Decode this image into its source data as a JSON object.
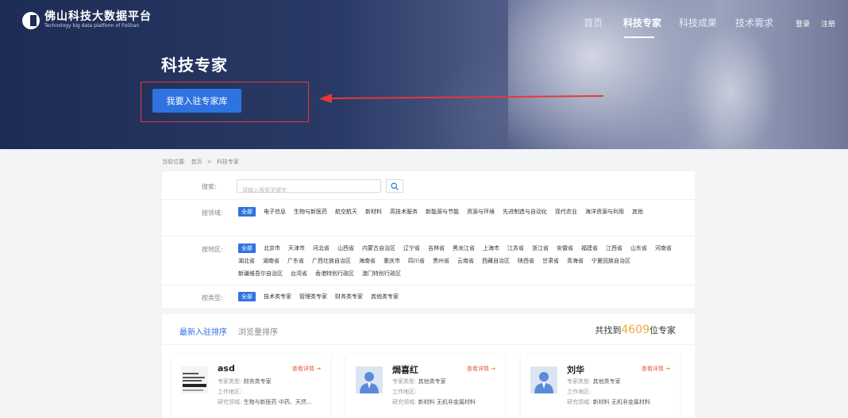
{
  "header": {
    "logo_title": "佛山科技大数据平台",
    "logo_subtitle": "Technology big data platform of FoShan",
    "nav": [
      "首页",
      "科技专家",
      "科技成果",
      "技术需求"
    ],
    "active_nav": "科技专家",
    "login": "登录",
    "register": "注册"
  },
  "hero": {
    "title": "科技专家",
    "join_button": "我要入驻专家库"
  },
  "breadcrumb": {
    "label": "当前位置:",
    "home": "首页",
    "separator": ">",
    "current": "科技专家"
  },
  "filter": {
    "search_label": "搜索:",
    "search_placeholder": "请输入搜索关键字",
    "field_label": "按领域:",
    "fields": [
      "全部",
      "电子信息",
      "生物与新医药",
      "航空航天",
      "新材料",
      "高技术服务",
      "新能源与节能",
      "资源与环境",
      "先进制造与自动化",
      "现代农业",
      "海洋资源与利用",
      "其他"
    ],
    "region_label": "按地区:",
    "regions": [
      "全部",
      "北京市",
      "天津市",
      "河北省",
      "山西省",
      "内蒙古自治区",
      "辽宁省",
      "吉林省",
      "黑龙江省",
      "上海市",
      "江苏省",
      "浙江省",
      "安徽省",
      "福建省",
      "江西省",
      "山东省",
      "河南省",
      "湖北省",
      "湖南省",
      "广东省",
      "广西壮族自治区",
      "海南省",
      "重庆市",
      "四川省",
      "贵州省",
      "云南省",
      "西藏自治区",
      "陕西省",
      "甘肃省",
      "青海省",
      "宁夏回族自治区",
      "新疆维吾尔自治区",
      "台湾省",
      "香港特别行政区",
      "澳门特别行政区"
    ],
    "type_label": "按类型:",
    "types": [
      "全部",
      "技术类专家",
      "管理类专家",
      "财务类专家",
      "其他类专家"
    ]
  },
  "list": {
    "sort_tabs": [
      "最新入驻排序",
      "浏览量排序"
    ],
    "total_prefix": "共找到",
    "total_count": "4609",
    "total_suffix": "位专家",
    "detail_label": "查看详情 →",
    "type_label": "专家类型:",
    "area_label": "工作地区:",
    "field_label": "研究领域:",
    "cards": [
      {
        "name": "asd",
        "type": "财务类专家",
        "area": "",
        "field": "生物与新医药 中药、天然..."
      },
      {
        "name": "焗喜红",
        "type": "其他类专家",
        "area": "",
        "field": "新材料 无机非金属材料"
      },
      {
        "name": "刘华",
        "type": "其他类专家",
        "area": "",
        "field": "新材料 无机非金属材料"
      }
    ]
  },
  "colors": {
    "accent": "#2f73e0",
    "highlight": "#e53935",
    "count": "#f4a93a"
  }
}
